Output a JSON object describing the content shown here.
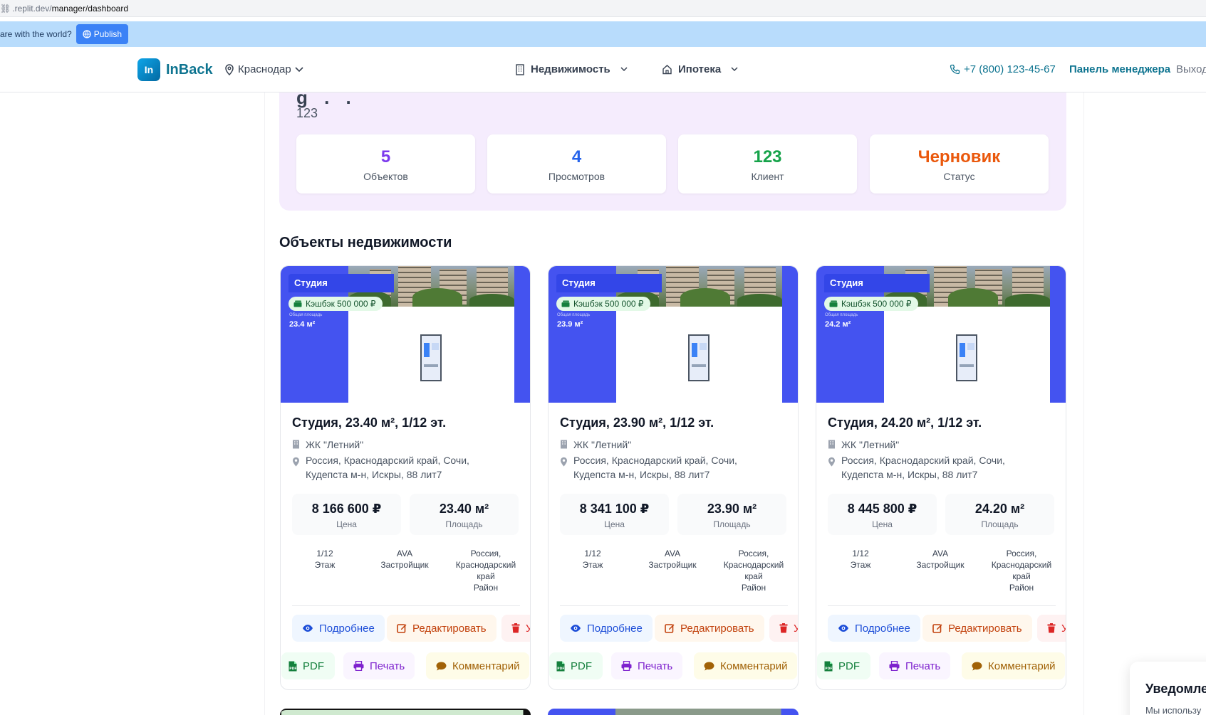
{
  "browser": {
    "url_prefix": ".replit.dev/",
    "url_path": "manager/dashboard"
  },
  "banner": {
    "text": "are with the world?",
    "publish_label": "Publish"
  },
  "header": {
    "logo_mark": "In",
    "logo_text": "InBack",
    "city": "Краснодар",
    "nav": [
      "Недвижимость",
      "Ипотека"
    ],
    "phone": "+7 (800) 123-45-67",
    "manager_panel": "Панель менеджера",
    "logout": "Выход"
  },
  "summary": {
    "title_partial": "g . .",
    "subtitle": "123",
    "stats": [
      {
        "value": "5",
        "label": "Объектов",
        "color": "#7c3aed"
      },
      {
        "value": "4",
        "label": "Просмотров",
        "color": "#2563eb"
      },
      {
        "value": "123",
        "label": "Клиент",
        "color": "#16a34a"
      },
      {
        "value": "Черновик",
        "label": "Статус",
        "color": "#ea580c"
      }
    ]
  },
  "section_title": "Объекты недвижимости",
  "properties": [
    {
      "tag": "Студия",
      "cashback": "Кэшбэк 500 000 ₽",
      "image_area": "23.4 м²",
      "title": "Студия, 23.40 м², 1/12 эт.",
      "complex": "ЖК \"Летний\"",
      "address_line1": "Россия, Краснодарский край, Сочи,",
      "address_line2": "Кудепста м-н, Искры, 88 лит7",
      "price": "8 166 600 ₽",
      "price_label": "Цена",
      "area": "23.40 м²",
      "area_label": "Площадь",
      "floor": "1/12",
      "floor_label": "Этаж",
      "developer": "AVA",
      "developer_label": "Застройщик",
      "district_l1": "Россия,",
      "district_l2": "Краснодарский",
      "district_l3": "край",
      "district_label": "Район",
      "btn_more": "Подробнее",
      "btn_edit": "Редактировать",
      "btn_delete": "У",
      "btn_pdf": "PDF",
      "btn_print": "Печать",
      "btn_comment": "Комментарий"
    },
    {
      "tag": "Студия",
      "cashback": "Кэшбэк 500 000 ₽",
      "image_area": "23.9 м²",
      "title": "Студия, 23.90 м², 1/12 эт.",
      "complex": "ЖК \"Летний\"",
      "address_line1": "Россия, Краснодарский край, Сочи,",
      "address_line2": "Кудепста м-н, Искры, 88 лит7",
      "price": "8 341 100 ₽",
      "price_label": "Цена",
      "area": "23.90 м²",
      "area_label": "Площадь",
      "floor": "1/12",
      "floor_label": "Этаж",
      "developer": "AVA",
      "developer_label": "Застройщик",
      "district_l1": "Россия,",
      "district_l2": "Краснодарский",
      "district_l3": "край",
      "district_label": "Район",
      "btn_more": "Подробнее",
      "btn_edit": "Редактировать",
      "btn_delete": "У",
      "btn_pdf": "PDF",
      "btn_print": "Печать",
      "btn_comment": "Комментарий"
    },
    {
      "tag": "Студия",
      "cashback": "Кэшбэк 500 000 ₽",
      "image_area": "24.2 м²",
      "title": "Студия, 24.20 м², 1/12 эт.",
      "complex": "ЖК \"Летний\"",
      "address_line1": "Россия, Краснодарский край, Сочи,",
      "address_line2": "Кудепста м-н, Искры, 88 лит7",
      "price": "8 445 800 ₽",
      "price_label": "Цена",
      "area": "24.20 м²",
      "area_label": "Площадь",
      "floor": "1/12",
      "floor_label": "Этаж",
      "developer": "AVA",
      "developer_label": "Застройщик",
      "district_l1": "Россия,",
      "district_l2": "Краснодарский",
      "district_l3": "край",
      "district_label": "Район",
      "btn_more": "Подробнее",
      "btn_edit": "Редактировать",
      "btn_delete": "У",
      "btn_pdf": "PDF",
      "btn_print": "Печать",
      "btn_comment": "Комментарий"
    }
  ],
  "notification": {
    "title": "Уведомле",
    "body": "Мы использу"
  }
}
